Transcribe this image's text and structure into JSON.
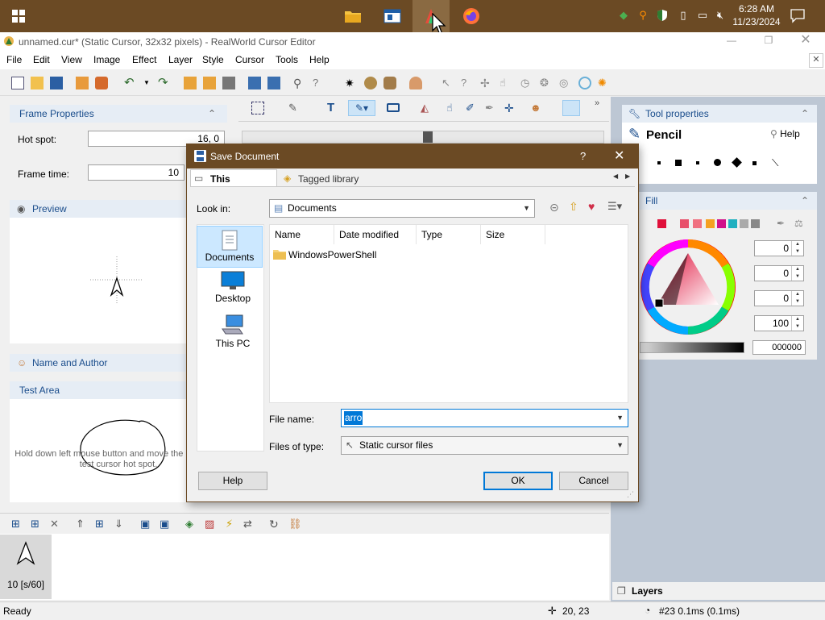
{
  "taskbar": {
    "clock_time": "6:28 AM",
    "clock_date": "11/23/2024"
  },
  "window": {
    "title": "unnamed.cur* (Static Cursor, 32x32 pixels) - RealWorld Cursor Editor"
  },
  "menu": [
    "File",
    "Edit",
    "View",
    "Image",
    "Effect",
    "Layer",
    "Style",
    "Cursor",
    "Tools",
    "Help"
  ],
  "frame_properties": {
    "header": "Frame Properties",
    "hot_spot_label": "Hot spot:",
    "hot_spot_value": "16, 0",
    "frame_time_label": "Frame time:",
    "frame_time_value": "10"
  },
  "preview": {
    "header": "Preview"
  },
  "name_author": {
    "header": "Name and Author"
  },
  "test_area": {
    "header": "Test Area",
    "text": "Hold down left mouse button and move the mouse to test cursor hot spot."
  },
  "frames": {
    "frame_label": "10 [s/60]"
  },
  "tool_properties": {
    "header": "Tool properties",
    "tool_name": "Pencil",
    "help": "Help"
  },
  "fill": {
    "header": "Fill",
    "values": [
      "0",
      "0",
      "0",
      "100"
    ],
    "hex": "000000"
  },
  "layers": {
    "header": "Layers"
  },
  "status": {
    "ready": "Ready",
    "coords": "20, 23",
    "frame_info": "#23 0.1ms (0.1ms)"
  },
  "dialog": {
    "title": "Save Document",
    "question": "?",
    "tab_this_computer": "This computer",
    "tab_tagged": "Tagged library",
    "look_in_label": "Look in:",
    "look_in_value": "Documents",
    "places": [
      "Documents",
      "Desktop",
      "This PC"
    ],
    "columns": [
      "Name",
      "Date modified",
      "Type",
      "Size"
    ],
    "files": [
      {
        "name": "WindowsPowerShell"
      }
    ],
    "file_name_label": "File name:",
    "file_name_value": "arro",
    "file_type_label": "Files of type:",
    "file_type_value": "Static cursor files",
    "help_button": "Help",
    "ok_button": "OK",
    "cancel_button": "Cancel"
  },
  "colors": {
    "taskbar": "#6b4a24",
    "accent": "#0078d7",
    "panel_header": "#1a4d8c"
  }
}
